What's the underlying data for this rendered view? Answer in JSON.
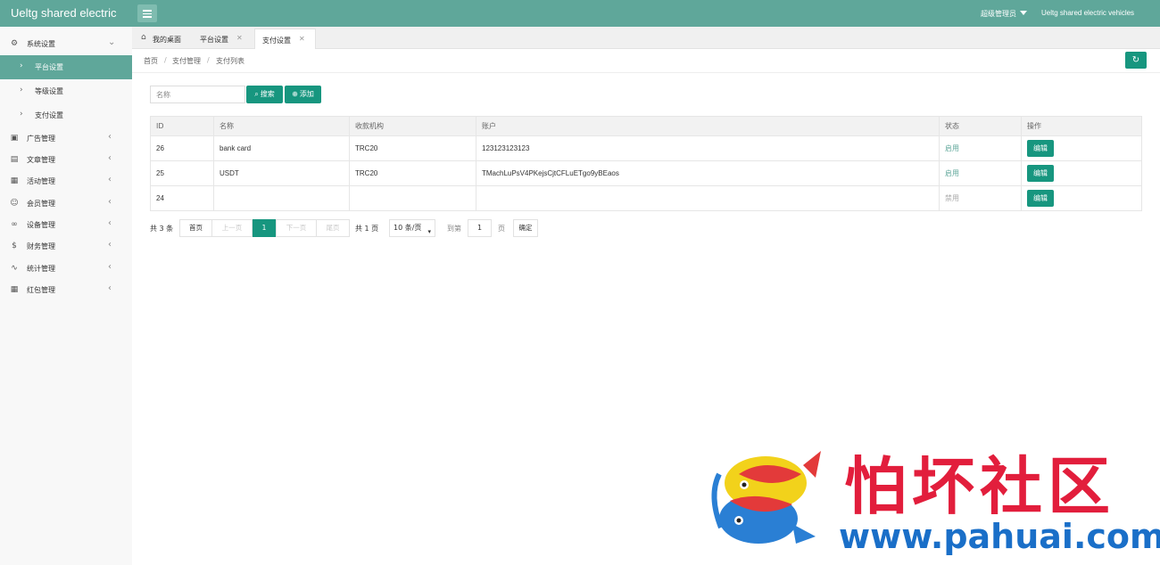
{
  "header": {
    "brand": "Ueltg shared electric",
    "user": "超级管理员",
    "site_name": "Ueltg shared electric vehicles"
  },
  "sidebar": {
    "items": [
      {
        "label": "系统设置",
        "icon": "gear-icon",
        "expanded": true
      },
      {
        "label": "平台设置",
        "active": true
      },
      {
        "label": "等级设置"
      },
      {
        "label": "支付设置"
      },
      {
        "label": "广告管理",
        "icon": "image-icon"
      },
      {
        "label": "文章管理",
        "icon": "book-icon"
      },
      {
        "label": "活动管理",
        "icon": "gift-icon"
      },
      {
        "label": "会员管理",
        "icon": "user-icon"
      },
      {
        "label": "设备管理",
        "icon": "bike-icon"
      },
      {
        "label": "财务管理",
        "icon": "money-icon"
      },
      {
        "label": "统计管理",
        "icon": "chart-icon"
      },
      {
        "label": "红包管理",
        "icon": "gift-icon"
      }
    ]
  },
  "tabs": [
    {
      "label": "我的桌面",
      "icon": "home-icon"
    },
    {
      "label": "平台设置",
      "closable": true
    },
    {
      "label": "支付设置",
      "closable": true,
      "active": true
    }
  ],
  "breadcrumb": [
    "首页",
    "支付管理",
    "支付列表"
  ],
  "search": {
    "placeholder": "名称",
    "search_label": "搜索",
    "add_label": "添加"
  },
  "table": {
    "columns": [
      "ID",
      "名称",
      "收款机构",
      "账户",
      "状态",
      "操作"
    ],
    "rows": [
      {
        "id": "26",
        "name": "bank card",
        "org": "TRC20",
        "account": "123123123123",
        "status": "启用",
        "enabled": true,
        "action": "编辑"
      },
      {
        "id": "25",
        "name": "USDT",
        "org": "TRC20",
        "account": "TMachLuPsV4PKejsCjtCFLuETgo9yBEaos",
        "status": "启用",
        "enabled": true,
        "action": "编辑"
      },
      {
        "id": "24",
        "name": "",
        "org": "",
        "account": "",
        "status": "禁用",
        "enabled": false,
        "action": "编辑"
      }
    ]
  },
  "pagination": {
    "total_text": "共 3 条",
    "first": "首页",
    "prev": "上一页",
    "current": "1",
    "next": "下一页",
    "last": "尾页",
    "pages_text": "共 1 页",
    "page_size": "10 条/页",
    "goto_label": "到第",
    "goto_value": "1",
    "page_unit": "页",
    "confirm": "确定"
  },
  "watermark": {
    "cn_text": "怕坏社区",
    "url": "www.pahuai.com"
  },
  "colors": {
    "header": "#5fa79a",
    "accent": "#17967f",
    "watermark_red": "#e21e3c",
    "watermark_blue": "#1a6fc8"
  }
}
